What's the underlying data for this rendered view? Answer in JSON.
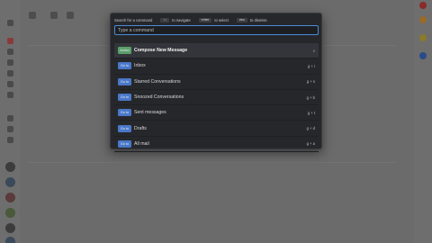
{
  "palette": {
    "hints": {
      "prefix": "Search for a command",
      "nav_keys": "↑↓",
      "nav_label": "to navigate",
      "select_key": "enter",
      "select_label": "to select",
      "dismiss_key": "esc",
      "dismiss_label": "to dismiss"
    },
    "search": {
      "placeholder": "Type a command",
      "value": ""
    },
    "items": [
      {
        "badge": "Action",
        "label": "Compose New Message",
        "shortcut": "c",
        "badge_type": "action",
        "selected": true
      },
      {
        "badge": "Go to",
        "label": "Inbox",
        "shortcut": "g + i",
        "badge_type": "goto"
      },
      {
        "badge": "Go to",
        "label": "Starred Conversations",
        "shortcut": "g + s",
        "badge_type": "goto"
      },
      {
        "badge": "Go to",
        "label": "Snoozed Conversations",
        "shortcut": "g + b",
        "badge_type": "goto"
      },
      {
        "badge": "Go to",
        "label": "Sent messages",
        "shortcut": "g + t",
        "badge_type": "goto"
      },
      {
        "badge": "Go to",
        "label": "Drafts",
        "shortcut": "g + d",
        "badge_type": "goto"
      },
      {
        "badge": "Go to",
        "label": "All mail",
        "shortcut": "g + a",
        "badge_type": "goto"
      }
    ]
  },
  "colors": {
    "palette_bg": "#26272b",
    "goto_badge": "#4a78c8",
    "action_badge": "#5a9e6a",
    "focus_border": "#4b8bd6"
  }
}
